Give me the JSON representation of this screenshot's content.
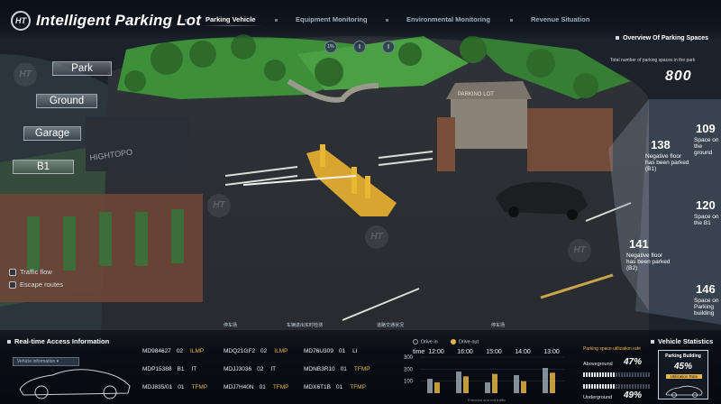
{
  "app": {
    "logo_text": "HT",
    "title": "Intelligent Parking Lot"
  },
  "nav": [
    {
      "label": "Parking Vehicle"
    },
    {
      "label": "Equipment Monitoring"
    },
    {
      "label": "Environmental Monitoring"
    },
    {
      "label": "Revenue Situation"
    }
  ],
  "view_controls": [
    "1%",
    "||",
    "||"
  ],
  "levels": [
    "Park",
    "Ground",
    "Garage",
    "B1"
  ],
  "layers": [
    "Traffic flow",
    "Escape routes"
  ],
  "scene": {
    "booth_sign": "PARKING LOT",
    "wall_sign": "HIGHTOPO",
    "watermark_text": "HT",
    "watermark_word": "HIGHTOPO"
  },
  "overview": {
    "title": "Overview Of Parking Spaces",
    "total_label": "Total number of parking spaces in the park",
    "total_value": "800",
    "floors": [
      {
        "count": "138",
        "label": "Negative floor has been parked (B1)"
      },
      {
        "count": "141",
        "label": "Negative floor has been parked (B2)"
      }
    ],
    "spaces": [
      {
        "count": "109",
        "label": "Space on the ground"
      },
      {
        "count": "120",
        "label": "Space on the B1"
      },
      {
        "count": "146",
        "label": "Space on Parking building"
      }
    ]
  },
  "bottom_tabs": [
    "停车场",
    "车辆进出实时检测",
    "道路交通状况",
    "停车场",
    "监控"
  ],
  "access": {
    "title": "Real-time Access Information",
    "vehicle_info_placeholder": "Vehicle information",
    "records": [
      [
        "MD984627",
        "02",
        "ILMP"
      ],
      [
        "MDQ21GF2",
        "02",
        "ILMP"
      ],
      [
        "MD76U309",
        "01",
        "LI"
      ],
      [
        "MDP15388",
        "B1",
        "IT"
      ],
      [
        "MDJJ3036",
        "02",
        "IT"
      ],
      [
        "MDNB3R10",
        "01",
        "TFMP"
      ],
      [
        "MDJ835/01",
        "01",
        "TFMP"
      ],
      [
        "MDJ7H40N",
        "01",
        "TFMP"
      ],
      [
        "MDX6T1B",
        "01",
        "TFMP"
      ]
    ]
  },
  "chart_data": {
    "type": "bar",
    "legend": [
      {
        "name": "Drive in",
        "color": "#9aa6b2"
      },
      {
        "name": "Drive out",
        "color": "#e4b64b"
      }
    ],
    "xlabel": "time",
    "categories": [
      "12:00",
      "16:00",
      "15:00",
      "14:00",
      "13:00"
    ],
    "yticks": [
      "100",
      "200",
      "300"
    ],
    "caption": "Entrance and exit traffic",
    "series": [
      {
        "name": "Drive in",
        "values": [
          120,
          180,
          90,
          150,
          210
        ]
      },
      {
        "name": "Drive out",
        "values": [
          90,
          140,
          160,
          100,
          170
        ]
      }
    ],
    "ylim": [
      0,
      300
    ]
  },
  "utilization": {
    "title": "Parking space utilization rate",
    "rows": [
      {
        "label": "Aboveground",
        "pct": "47%",
        "value": 0.47
      },
      {
        "label": "Underground",
        "pct": "49%",
        "value": 0.49
      }
    ]
  },
  "vehicle_stats": {
    "title": "Vehicle Statistics",
    "box_title": "Parking Building",
    "box_pct": "45%",
    "box_sub": "Utilization Rate"
  }
}
